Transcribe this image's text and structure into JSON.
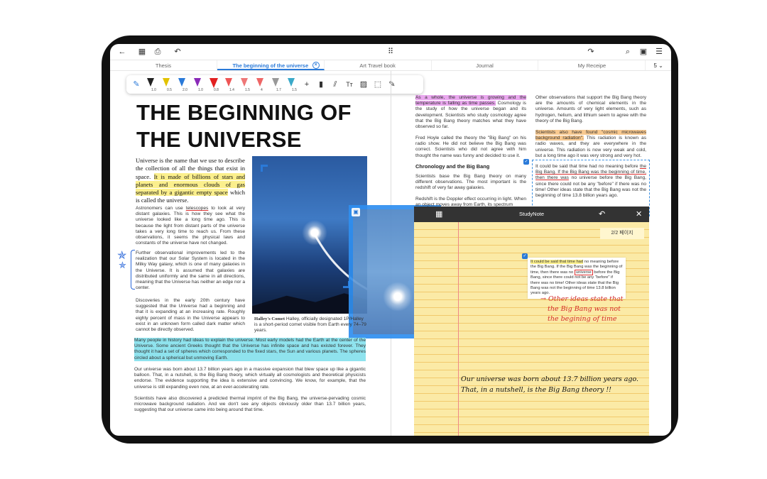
{
  "toolbar": {
    "back_icon": "←",
    "grid_icon": "▦",
    "export_icon": "⎙",
    "undo_icon": "↶",
    "apps_icon": "⠿",
    "redo_icon": "↷",
    "search_icon": "⌕",
    "bookmark_icon": "▣",
    "menu_icon": "☰"
  },
  "tabs": [
    {
      "label": "Thesis"
    },
    {
      "label": "The beginning of the universe",
      "active": true
    },
    {
      "label": "Art Travel book"
    },
    {
      "label": "Journal"
    },
    {
      "label": "My Receipe"
    }
  ],
  "tab_count": "5",
  "pen_toolbar": {
    "pens": [
      {
        "size": "1.0",
        "color": "#222222"
      },
      {
        "size": "0.5",
        "color": "#e2c200"
      },
      {
        "size": "2.0",
        "color": "#2a7ad9"
      },
      {
        "size": "1.0",
        "color": "#8a2ab8"
      },
      {
        "size": "0.8",
        "color": "#e22020"
      },
      {
        "size": "1.4",
        "color": "#ffffff"
      },
      {
        "size": "1.5",
        "color": "#ffffff"
      },
      {
        "size": "4",
        "color": "#ffffff"
      },
      {
        "size": "1.7",
        "color": "#ffffff"
      },
      {
        "size": "1.5",
        "color": "#ffffff"
      }
    ],
    "add": "+",
    "text_tool": "Tт",
    "image_tool": "▨",
    "lasso_tool": "⬚",
    "eyedrop_tool": "✎"
  },
  "left_page": {
    "title_line1": "THE BEGINNING OF",
    "title_line2": "THE UNIVERSE",
    "lead_a": "Universe is the name that we use to describe the collection of all the things that exist in space. ",
    "lead_hl": "It is made of billions of stars and planets and enormous clouds of gas separated by a gigantic empty space",
    "lead_b": " which is called the universe.",
    "p1_a": "Astronomers can use ",
    "p1_ul": "telescopes",
    "p1_b": " to look at very distant galaxies. This is how they see what the universe looked like a long time ago. This is because the light from distant parts of the universe takes a very long time to reach us. From these observations, it seems the physical laws and constants of the universe have not changed.",
    "p2": "Further observational improvements led to the realization that our Solar System is located in the Milky Way galaxy, which is one of many galaxies in the Universe. It is assumed that galaxies are distributed uniformly and the same in all directions, meaning that the Universe has neither an edge nor a center.",
    "p3": "Discoveries in the early 20th century have suggested that the Universe had a beginning and that it is expanding at an increasing rate. Roughly eighty percent of mass in the Universe appears to exist in an unknown form called dark matter which cannot be directly observed.",
    "p4_hl": "Many people in history had ideas to explain the universe. Most early models had the Earth at the center of the Universe. Some ancient Greeks thought that the Universe has infinite space and has existed forever. They thought it had a set of spheres which corresponded to the fixed stars, the Sun and various planets. The spheres circled about a spherical but unmoving Earth.",
    "p5": "Our universe was born about 13.7 billion years ago in a massive expansion that blew space up like a gigantic balloon. That, in a nutshell, is the Big Bang theory, which virtually all cosmologists and theoretical physicists endorse. The evidence supporting the idea is extensive and convincing. We know, for example, that the universe is still expanding even now, at an ever-accelerating rate.",
    "p6": "Scientists have also discovered a predicted thermal imprint of the Big Bang, the universe-pervading cosmic microwave background radiation. And we don't see any objects obviously older than 13.7 billion years, suggesting that our universe came into being around that time.",
    "caption_name": "Halley's Comet",
    "caption_text": " Halley, officially designated 1P/Halley is a short-period comet visible from Earth every 74–79 years.",
    "star_mark": "✯"
  },
  "right_page": {
    "c1_hl": "As a whole, the universe is growing and the temperature is falling as time passes.",
    "c1_b": " Cosmology is the study of how the universe began and its development. Scientists who study cosmology agree that the Big Bang theory matches what they have observed so far.",
    "c2": "Fred Hoyle called the theory the \"Big Bang\" on his radio show. He did not believe the Big Bang was correct. Scientists who did not agree with him thought the name was funny and decided to use it.",
    "heading": "Chronology and the Big Bang",
    "c3": "Scientists base the Big Bang theory on many different observations. The most important is the redshift of very far away galaxies.",
    "c4": "Redshift is the Doppler effect occurring in light. When an object moves away from Earth, its spectrum",
    "d1": "Other observations that support the Big Bang theory are the amounts of chemical elements in the universe. Amounts of very light elements, such as hydrogen, helium, and lithium seem to agree with the theory of the Big Bang.",
    "d2_hl": "Scientists also have found \"cosmic microwaves background radiation\".",
    "d2_b": " This radiation is known as radio waves, and they are everywhere in the universe. This radiation is now very weak and cold, but a long time ago it was very strong and very hot.",
    "d3_a": "It could be said that time had no meaning before ",
    "d3_ul": "the Big Bang. If the Big Bang was the beginning of time, then there was",
    "d3_b": " no universe before the Big Bang, since there could not be any \"before\" if there was no time! Other ideas state that the Big Bang was not the beginning of time 13.8 billion years ago."
  },
  "study_note": {
    "title": "StudyNote",
    "grid_icon": "▦",
    "undo_icon": "↶",
    "close_icon": "✕",
    "page_badge": "2/2 페이지",
    "quote_hl": "It could be said that time had",
    "quote_a": " no meaning before the Big Bang. If the Big Bang was the beginning of time, then there was no ",
    "quote_box": "universe",
    "quote_b": " before the Big Bang, since there could not be any \"before\" if there was no time! Other ideas state that the Big Bang was not the beginning of time 13.8 billion years ago.",
    "red_line1": "→ Other ideas state that",
    "red_line2": "the Big Bang was not",
    "red_line3": "the begining of time",
    "black_line1": "Our universe was born about 13.7 billion years ago.",
    "black_line2": "That, in a nutshell, is the Big Bang theory !!"
  },
  "colors": {
    "accent": "#2a7ad9",
    "highlight_yellow": "#fbef8c",
    "highlight_cyan": "#8fe3ee",
    "highlight_pink": "#e9a7ee",
    "highlight_orange": "#f8c990",
    "note_paper": "#fbeaa6"
  }
}
